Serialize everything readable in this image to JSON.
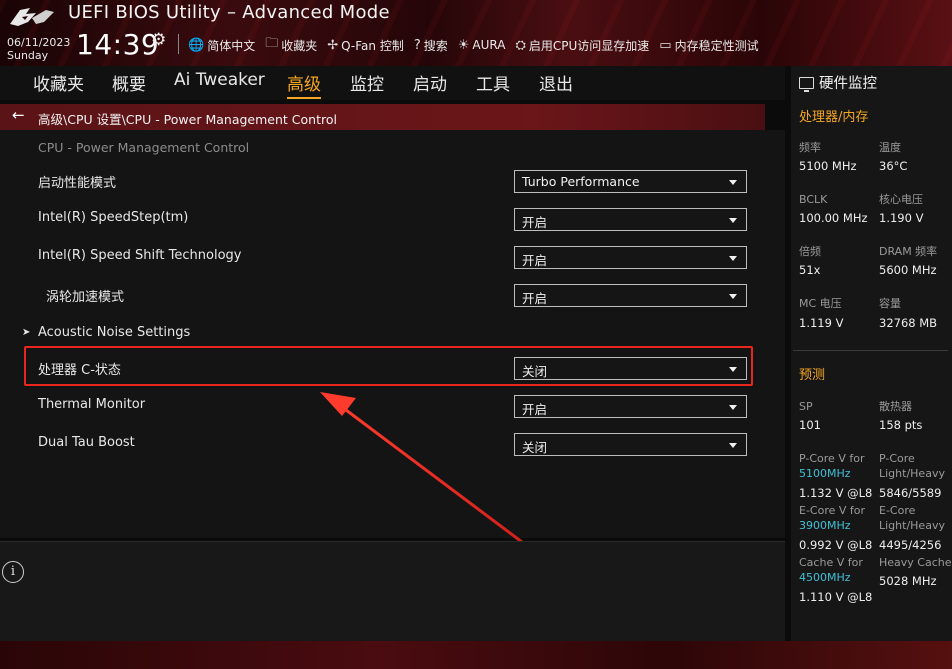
{
  "header": {
    "title": "UEFI BIOS Utility – Advanced Mode",
    "date": "06/11/2023",
    "day": "Sunday",
    "time": "14:39",
    "tools": [
      {
        "icon": "globe-icon",
        "glyph": "🌐",
        "label": "简体中文"
      },
      {
        "icon": "favorites-icon",
        "glyph": "🗀",
        "label": "收藏夹"
      },
      {
        "icon": "fan-icon",
        "glyph": "✢",
        "label": "Q-Fan 控制"
      },
      {
        "icon": "search-icon",
        "glyph": "?",
        "label": "搜索"
      },
      {
        "icon": "aura-icon",
        "glyph": "☀",
        "label": "AURA"
      },
      {
        "icon": "resize-bar-icon",
        "glyph": "⛭",
        "label": "启用CPU访问显存加速"
      },
      {
        "icon": "memtest-icon",
        "glyph": "▭",
        "label": "内存稳定性测试"
      }
    ]
  },
  "menu": {
    "tabs": [
      "收藏夹",
      "概要",
      "Ai Tweaker",
      "高级",
      "监控",
      "启动",
      "工具",
      "退出"
    ],
    "active": "高级"
  },
  "breadcrumb": "高级\\CPU 设置\\CPU - Power Management Control",
  "main": {
    "section_title": "CPU - Power Management Control",
    "rows": [
      {
        "label": "启动性能模式",
        "value": "Turbo Performance"
      },
      {
        "label": "Intel(R) SpeedStep(tm)",
        "value": "开启"
      },
      {
        "label": "Intel(R) Speed Shift Technology",
        "value": "开启"
      },
      {
        "label": "涡轮加速模式",
        "value": "开启"
      },
      {
        "label": "Acoustic Noise Settings",
        "submenu": true
      },
      {
        "label": "处理器 C-状态",
        "value": "关闭",
        "highlighted": true
      },
      {
        "label": "Thermal Monitor",
        "value": "开启"
      },
      {
        "label": "Dual Tau Boost",
        "value": "关闭"
      }
    ]
  },
  "hw_monitor": {
    "title": "硬件监控",
    "cpu_mem_title": "处理器/内存",
    "cpu_mem": [
      {
        "k": "频率",
        "v": "5100 MHz"
      },
      {
        "k": "温度",
        "v": "36°C"
      },
      {
        "k": "BCLK",
        "v": "100.00 MHz"
      },
      {
        "k": "核心电压",
        "v": "1.190 V"
      },
      {
        "k": "倍频",
        "v": "51x"
      },
      {
        "k": "DRAM 频率",
        "v": "5600 MHz"
      },
      {
        "k": "MC 电压",
        "v": "1.119 V"
      },
      {
        "k": "容量",
        "v": "32768 MB"
      }
    ],
    "predict_title": "预测",
    "predict": {
      "sp_k": "SP",
      "sp_v": "101",
      "cooler_k": "散热器",
      "cooler_v": "158 pts",
      "pcore_k": "P-Core V for",
      "pcore_freq": "5100MHz",
      "pcore_v": "1.132 V @L8",
      "pcore_lh_k1": "P-Core",
      "pcore_lh_k2": "Light/Heavy",
      "pcore_lh_v": "5846/5589",
      "ecore_k": "E-Core V for",
      "ecore_freq": "3900MHz",
      "ecore_v": "0.992 V @L8",
      "ecore_lh_k1": "E-Core",
      "ecore_lh_k2": "Light/Heavy",
      "ecore_lh_v": "4495/4256",
      "cache_k": "Cache V for",
      "cache_freq": "4500MHz",
      "cache_v": "1.110 V @L8",
      "hcache_k": "Heavy Cache",
      "hcache_v": "5028 MHz"
    }
  },
  "colors": {
    "accent": "#f5a623",
    "highlight": "#e8261e",
    "freq": "#3fc1d6"
  }
}
